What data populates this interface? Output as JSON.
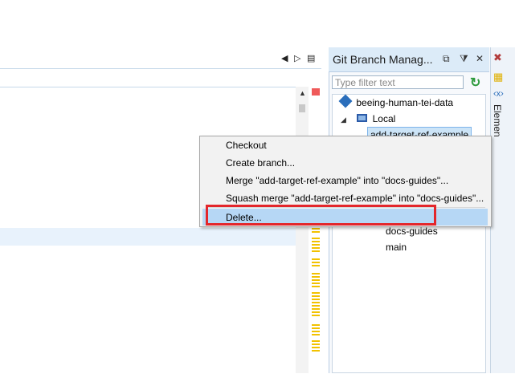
{
  "editor": {
    "nav_prev_icon": "triangle-left-icon",
    "nav_next_icon": "triangle-right-icon",
    "nav_list_icon": "list-icon"
  },
  "git_branch_manager": {
    "title": "Git Branch Manag...",
    "filter": {
      "placeholder": "Type filter text",
      "value": ""
    },
    "tree": {
      "repository": "beeing-human-tei-data",
      "local_label": "Local",
      "branches": [
        "add-target-ref-example",
        "docs-guides",
        "main"
      ],
      "selected_branch": "add-target-ref-example"
    }
  },
  "side_panel": {
    "elements_label": "Elemen"
  },
  "context_menu": {
    "items": [
      "Checkout",
      "Create branch...",
      "Merge \"add-target-ref-example\" into \"docs-guides\"...",
      "Squash merge \"add-target-ref-example\" into \"docs-guides\"...",
      "Delete..."
    ],
    "highlighted_item": "Delete..."
  },
  "colors": {
    "panel_header": "#dcebf8",
    "selection": "#cce4f7",
    "menu_hover": "#b6d7f5",
    "annotation_red": "#e3262b",
    "error_marker": "#ef5a5a",
    "warning_marker": "#f2c200"
  }
}
